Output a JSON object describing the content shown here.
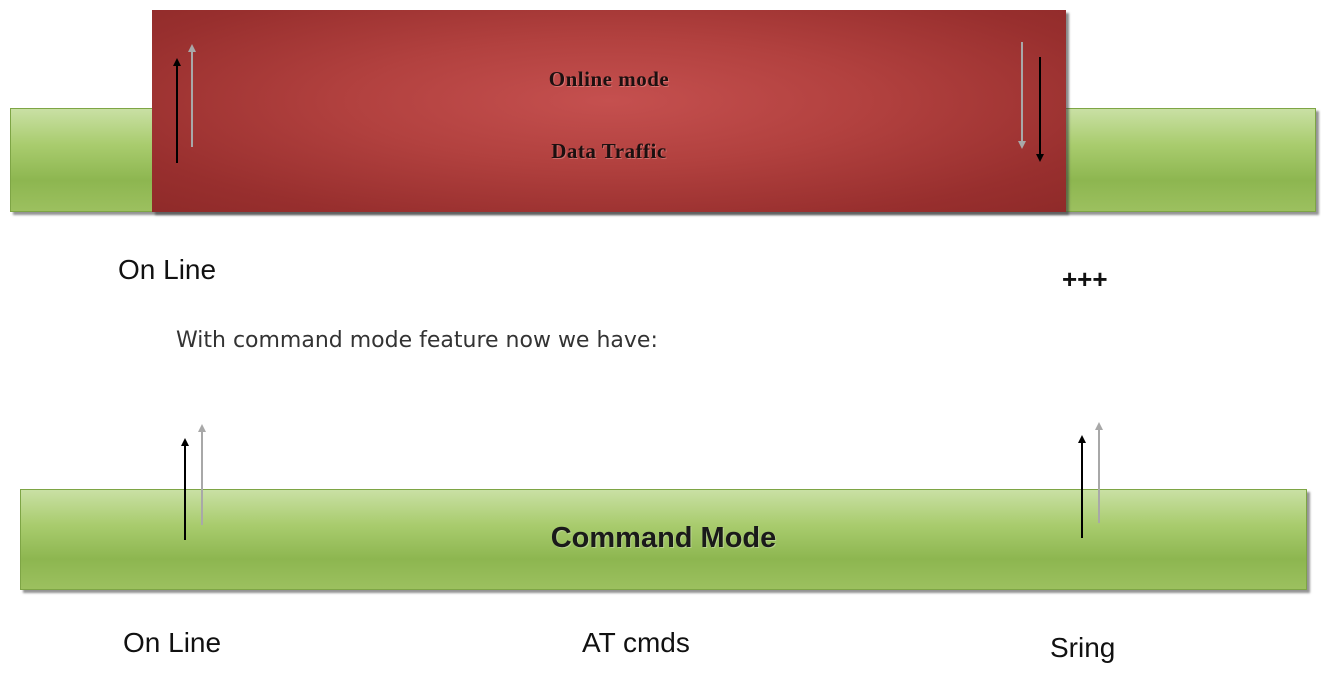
{
  "online_block": {
    "title": "Online mode",
    "subtitle": "Data Traffic"
  },
  "top_labels": {
    "left": "On Line",
    "right": "+++"
  },
  "caption": "With command mode feature now we have:",
  "command_bar": {
    "title": "Command Mode"
  },
  "bottom_labels": {
    "left": "On Line",
    "middle": "AT cmds",
    "right": "Sring"
  },
  "colors": {
    "online_block": "#b2413f",
    "green_bar": "#a9cc6e",
    "arrow_dark": "#000000",
    "arrow_light": "#a8a8a8"
  }
}
